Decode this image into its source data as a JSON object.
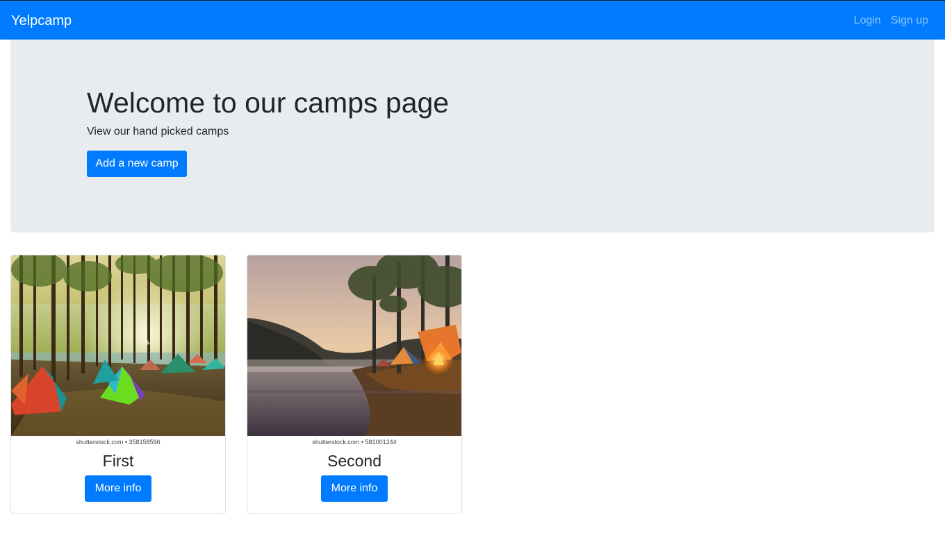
{
  "navbar": {
    "brand": "Yelpcamp",
    "links": [
      {
        "label": "Login"
      },
      {
        "label": "Sign up"
      }
    ]
  },
  "jumbotron": {
    "title": "Welcome to our camps page",
    "subtitle": "View our hand picked camps",
    "button_label": "Add a new camp"
  },
  "camps": [
    {
      "name": "First",
      "image_credit": "shutterstock.com • 358158596",
      "button_label": "More info"
    },
    {
      "name": "Second",
      "image_credit": "shutterstock.com • 581001244",
      "button_label": "More info"
    }
  ],
  "colors": {
    "primary": "#007bff",
    "jumbotron_bg": "#e9ecef",
    "text": "#212529"
  }
}
